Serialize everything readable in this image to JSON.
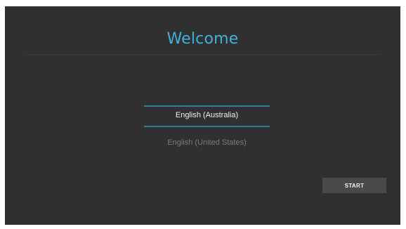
{
  "setup": {
    "title": "Welcome",
    "language_picker": {
      "selected": "English (Australia)",
      "next_option": "English (United States)"
    },
    "start_label": "START"
  },
  "colors": {
    "background": "#303030",
    "title": "#3fb0dc",
    "picker_line": "#2a7fa0",
    "button": "#4a4a4a"
  }
}
